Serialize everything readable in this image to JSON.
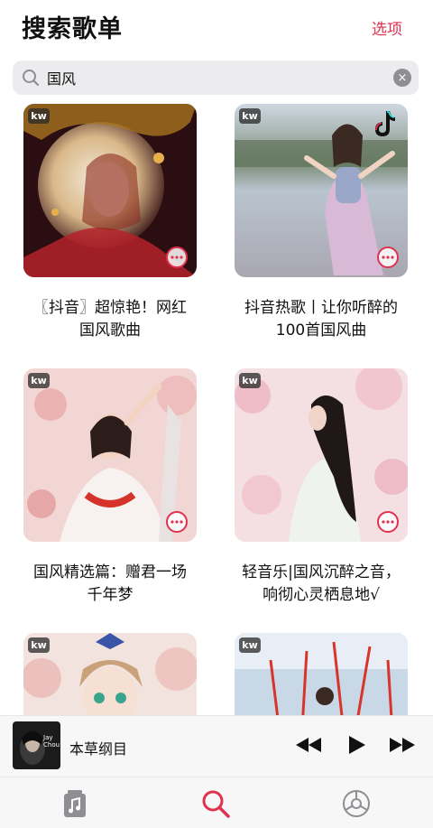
{
  "header": {
    "title": "搜索歌单",
    "options_label": "选项"
  },
  "search": {
    "value": "国风",
    "clear_icon": "×"
  },
  "accent_color": "#e0324f",
  "playlists": [
    {
      "source": "kw",
      "title_line1": "〖抖音〗超惊艳！网红",
      "title_line2": "国风歌曲",
      "tiktok_logo": false
    },
    {
      "source": "kw",
      "title_line1": "抖音热歌丨让你听醉的",
      "title_line2": "100首国风曲",
      "tiktok_logo": true
    },
    {
      "source": "kw",
      "title_line1": "国风精选篇：赠君一场",
      "title_line2": "千年梦",
      "tiktok_logo": false
    },
    {
      "source": "kw",
      "title_line1": "轻音乐|国风沉醉之音，",
      "title_line2": "响彻心灵栖息地√",
      "tiktok_logo": false
    },
    {
      "source": "kw",
      "title_line1": "",
      "title_line2": "",
      "tiktok_logo": false
    },
    {
      "source": "kw",
      "title_line1": "",
      "title_line2": "",
      "tiktok_logo": false
    }
  ],
  "mini_player": {
    "track_title": "本草纲目",
    "art_text_1": "Jay",
    "art_text_2": "Chou"
  },
  "tabs": [
    {
      "name": "library",
      "icon": "music-file-icon",
      "active": false
    },
    {
      "name": "search",
      "icon": "search-icon",
      "active": true
    },
    {
      "name": "settings",
      "icon": "settings-icon",
      "active": false
    }
  ]
}
